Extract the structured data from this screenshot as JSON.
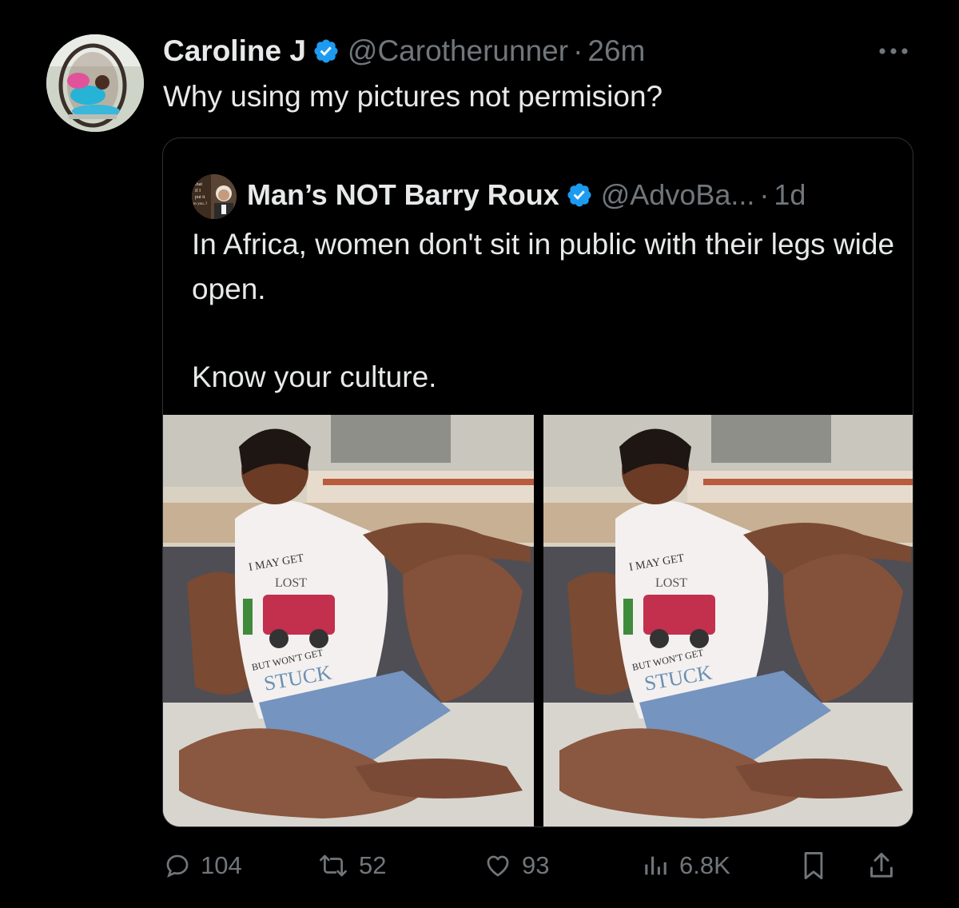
{
  "author": {
    "display_name": "Caroline J",
    "handle": "@Carotherunner",
    "time": "26m",
    "verified": true
  },
  "tweet": {
    "text": "Why using my pictures not permision?"
  },
  "quoted_tweet": {
    "display_name": "Man’s NOT Barry Roux",
    "handle": "@AdvoBa...",
    "time": "1d",
    "verified": true,
    "avatar_caption_lines": [
      "that",
      "if I",
      "put it",
      "to you..?"
    ],
    "text_lines": [
      "In Africa, women don't sit in public with their legs wide open.",
      "Know your culture."
    ],
    "photos": [
      {
        "shirt_text_top": "I MAY GET",
        "shirt_text_mid": "LOST",
        "shirt_text_low": "BUT WON'T GET",
        "shirt_text_bottom": "STUCK"
      },
      {
        "shirt_text_top": "I MAY GET",
        "shirt_text_mid": "LOST",
        "shirt_text_low": "BUT WON'T GET",
        "shirt_text_bottom": "STUCK"
      }
    ]
  },
  "actions": {
    "replies": "104",
    "retweets": "52",
    "likes": "93",
    "views": "6.8K"
  },
  "colors": {
    "background": "#000000",
    "text_primary": "#e7e9ea",
    "text_secondary": "#71767b",
    "verified_badge": "#1d9bf0",
    "border": "#2f3336"
  },
  "icons": {
    "more": "more-dots-icon",
    "verified": "verified-badge-icon",
    "reply": "reply-icon",
    "retweet": "retweet-icon",
    "like": "heart-icon",
    "views": "views-chart-icon",
    "bookmark": "bookmark-icon",
    "share": "share-icon"
  }
}
